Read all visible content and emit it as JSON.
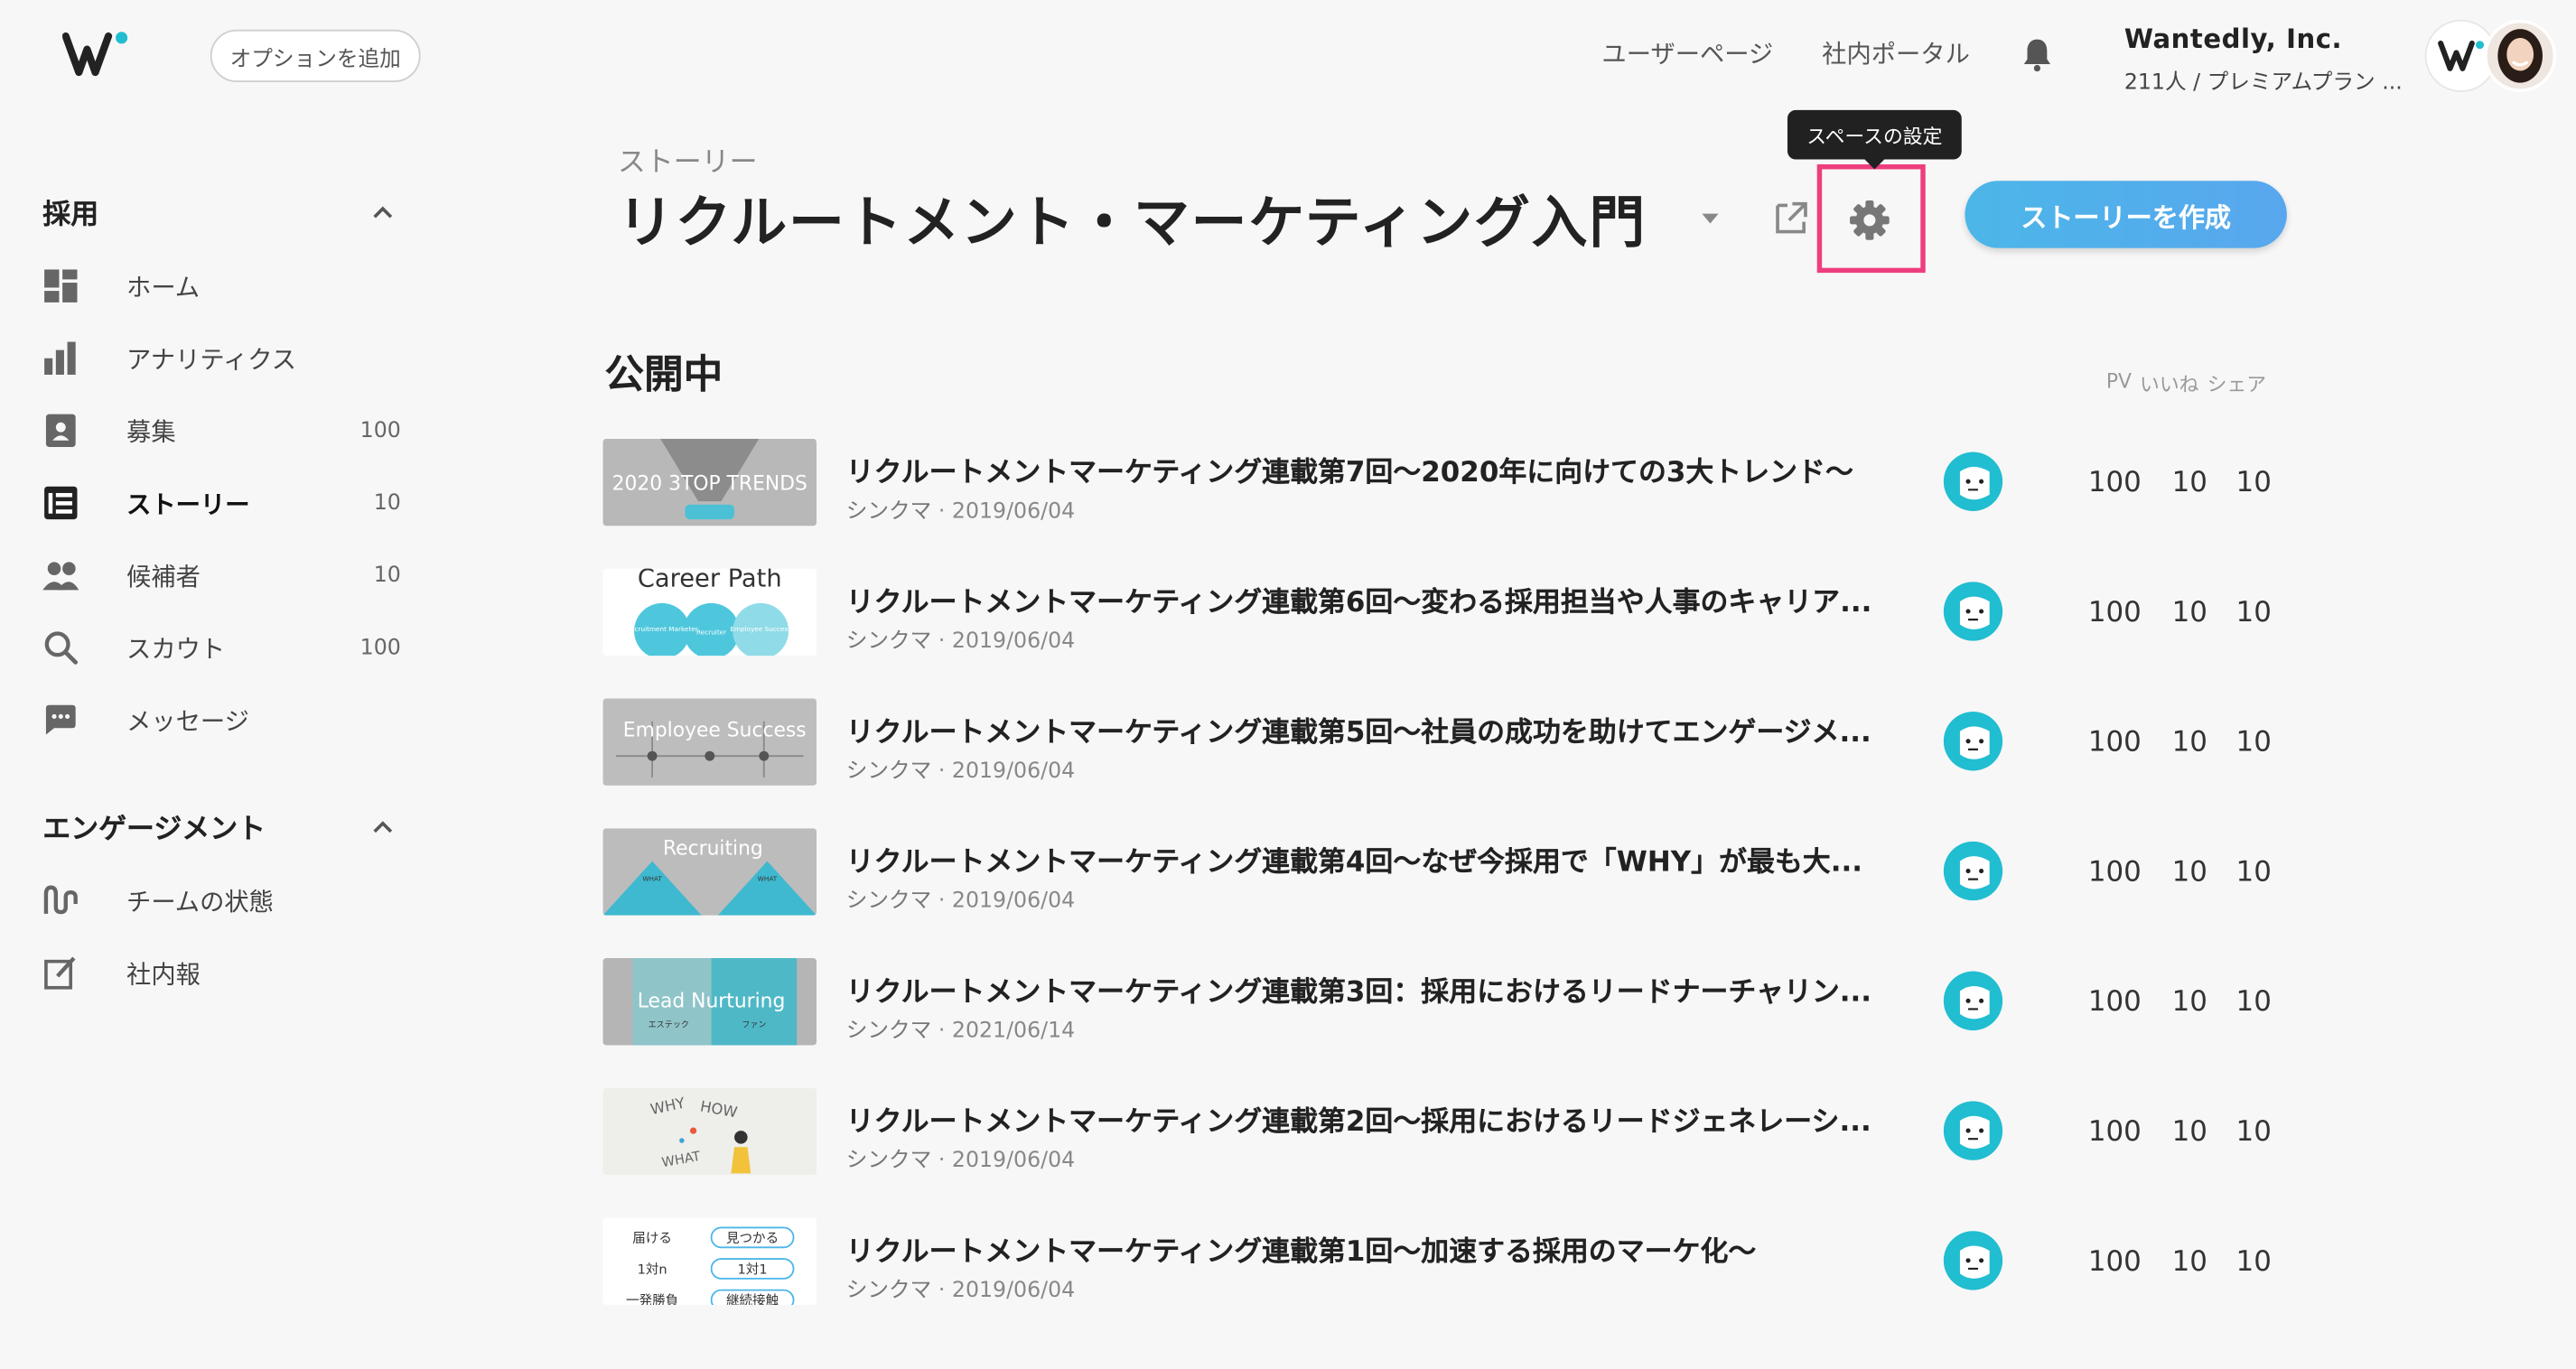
{
  "header": {
    "add_option": "オプションを追加",
    "user_page": "ユーザーページ",
    "portal": "社内ポータル",
    "company_name": "Wantedly, Inc.",
    "company_sub": "211人 / プレミアムプラン ..."
  },
  "sidebar": {
    "recruit_section": "採用",
    "engagement_section": "エンゲージメント",
    "items": [
      {
        "label": "ホーム",
        "count": ""
      },
      {
        "label": "アナリティクス",
        "count": ""
      },
      {
        "label": "募集",
        "count": "100"
      },
      {
        "label": "ストーリー",
        "count": "10"
      },
      {
        "label": "候補者",
        "count": "10"
      },
      {
        "label": "スカウト",
        "count": "100"
      },
      {
        "label": "メッセージ",
        "count": ""
      },
      {
        "label": "チームの状態",
        "count": ""
      },
      {
        "label": "社内報",
        "count": ""
      }
    ]
  },
  "main": {
    "breadcrumb": "ストーリー",
    "space_title": "リクルートメント・マーケティング入門",
    "tooltip": "スペースの設定",
    "create_button": "ストーリーを作成",
    "published_title": "公開中",
    "col_pv": "PV",
    "col_like": "いいね",
    "col_share": "シェア",
    "thumbs": {
      "t1": "2020 3TOP TRENDS",
      "t2_title": "Career Path",
      "t2_c1": "Recruitment Marketer",
      "t2_c2": "Recruiter",
      "t2_c3": "Employee Success",
      "t3": "Employee Success",
      "t4": "Recruiting",
      "t4_left": "WHAT",
      "t4_right": "WHAT",
      "t5": "Lead Nurturing",
      "t5_left": "エステック",
      "t5_right": "ファン",
      "t6_a": "WHY",
      "t6_b": "HOW",
      "t6_c": "WHAT",
      "t7_l1": "届ける",
      "t7_l2": "1対n",
      "t7_l3": "一発勝負",
      "t7_r1": "見つかる",
      "t7_r2": "1対1",
      "t7_r3": "継続接触"
    },
    "stories": [
      {
        "title": "リクルートメントマーケティング連載第7回〜2020年に向けての3大トレンド〜",
        "author": "シンクマ",
        "date": "2019/06/04",
        "pv": "100",
        "likes": "10",
        "shares": "10"
      },
      {
        "title": "リクルートメントマーケティング連載第6回〜変わる採用担当や人事のキャリア...",
        "author": "シンクマ",
        "date": "2019/06/04",
        "pv": "100",
        "likes": "10",
        "shares": "10"
      },
      {
        "title": "リクルートメントマーケティング連載第5回〜社員の成功を助けてエンゲージメ...",
        "author": "シンクマ",
        "date": "2019/06/04",
        "pv": "100",
        "likes": "10",
        "shares": "10"
      },
      {
        "title": "リクルートメントマーケティング連載第4回〜なぜ今採用で「WHY」が最も大...",
        "author": "シンクマ",
        "date": "2019/06/04",
        "pv": "100",
        "likes": "10",
        "shares": "10"
      },
      {
        "title": "リクルートメントマーケティング連載第3回：採用におけるリードナーチャリン...",
        "author": "シンクマ",
        "date": "2021/06/14",
        "pv": "100",
        "likes": "10",
        "shares": "10"
      },
      {
        "title": "リクルートメントマーケティング連載第2回〜採用におけるリードジェネレーシ...",
        "author": "シンクマ",
        "date": "2019/06/04",
        "pv": "100",
        "likes": "10",
        "shares": "10"
      },
      {
        "title": "リクルートメントマーケティング連載第1回〜加速する採用のマーケ化〜",
        "author": "シンクマ",
        "date": "2019/06/04",
        "pv": "100",
        "likes": "10",
        "shares": "10"
      }
    ]
  },
  "colors": {
    "accent_blue": "#4cb6e8",
    "highlight_pink": "#ee3e7d",
    "teal": "#21bdd1"
  }
}
